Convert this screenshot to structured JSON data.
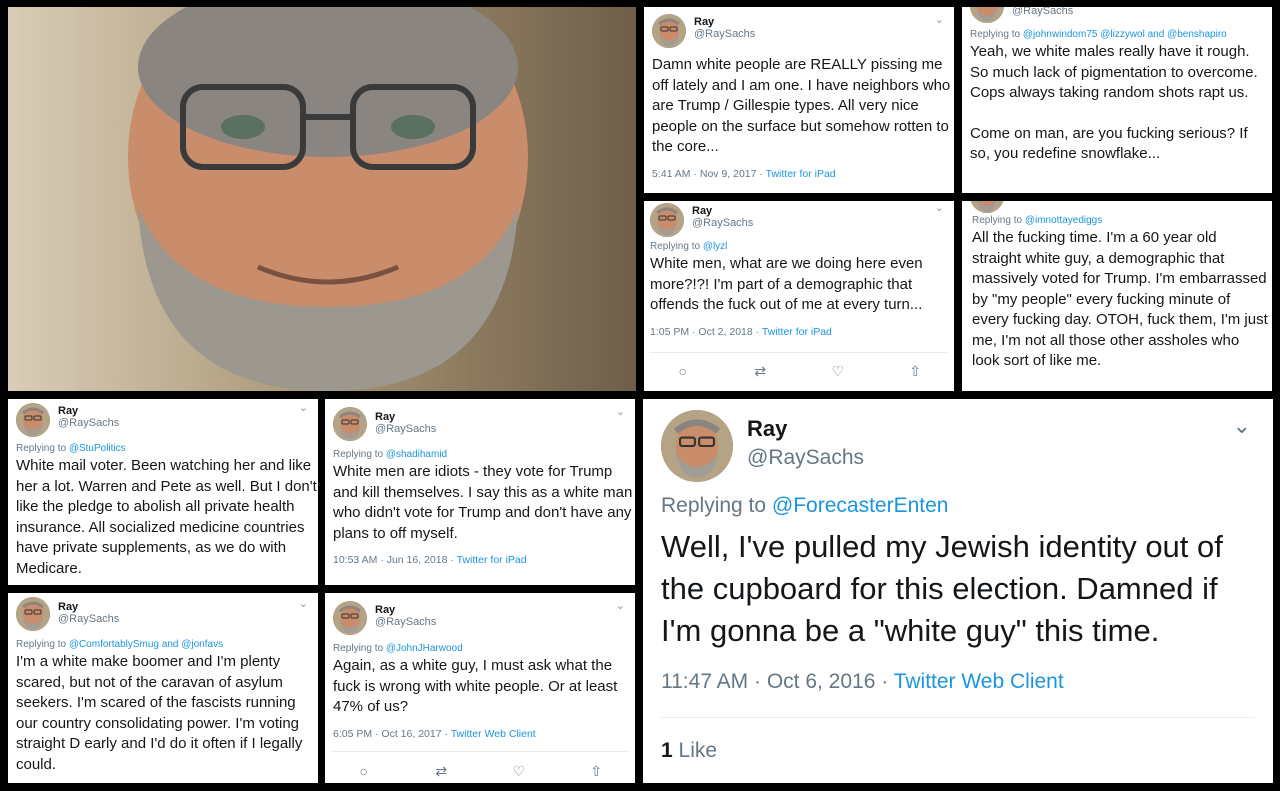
{
  "colors": {
    "link": "#1b95e0",
    "muted": "#657786",
    "text": "#14171a"
  },
  "tweets": {
    "t1": {
      "name": "Ray",
      "handle": "@RaySachs",
      "text": "Damn white people are REALLY pissing me off lately and I am one. I have neighbors who are Trump / Gillespie types. All very nice people on the surface but somehow rotten to the core...",
      "time": "5:41 AM · Nov 9, 2017 · ",
      "client": "Twitter for iPad"
    },
    "t2": {
      "handle": "@RaySachs",
      "replying": "Replying to ",
      "reply_to": "@johnwindom75 @lizzywol and @benshapiro",
      "text": "Yeah, we white males really have it rough. So much lack of pigmentation to overcome. Cops always taking random shots rapt us.",
      "text2": "Come on man, are you fucking serious? If so, you redefine snowflake..."
    },
    "t3": {
      "name": "Ray",
      "handle": "@RaySachs",
      "replying": "Replying to ",
      "reply_to": "@lyzl",
      "text": "White men, what are we doing here even more?!?! I'm part of a demographic that offends the fuck out of me at every turn...",
      "time": "1:05 PM · Oct 2, 2018 · ",
      "client": "Twitter for iPad"
    },
    "t4": {
      "replying": "Replying to ",
      "reply_to": "@imnottayediggs",
      "text": "All the fucking time. I'm a 60 year old straight white guy, a demographic that massively voted for Trump. I'm embarrassed by \"my people\" every fucking minute of every fucking day. OTOH, fuck them, I'm just me, I'm not all those other assholes who look sort of like me."
    },
    "t5": {
      "name": "Ray",
      "handle": "@RaySachs",
      "replying": "Replying to ",
      "reply_to": "@StuPolitics",
      "text": "White mail voter. Been watching her and like her a lot. Warren and Pete as well. But I don't like the pledge to abolish all private health insurance. All socialized medicine countries have private supplements, as we do with Medicare."
    },
    "t6": {
      "name": "Ray",
      "handle": "@RaySachs",
      "replying": "Replying to ",
      "reply_to": "@shadihamid",
      "text": "White men are idiots - they vote for Trump and kill themselves. I say this as a white man who didn't vote for Trump and don't have any plans to off myself.",
      "time": "10:53 AM · Jun 16, 2018 · ",
      "client": "Twitter for iPad"
    },
    "t7": {
      "name": "Ray",
      "handle": "@RaySachs",
      "replying": "Replying to ",
      "reply_to": "@ComfortablySmug and @jonfavs",
      "text": "I'm a white make boomer and I'm plenty scared, but not of the caravan of asylum seekers. I'm scared of the fascists running our country consolidating power. I'm voting straight D early and I'd do it often if I legally could."
    },
    "t8": {
      "name": "Ray",
      "handle": "@RaySachs",
      "replying": "Replying to ",
      "reply_to": "@JohnJHarwood",
      "text": "Again, as a white guy, I must ask what the fuck is wrong with white people. Or at least 47% of us?",
      "time": "6:05 PM · Oct 16, 2017 · ",
      "client": "Twitter Web Client"
    },
    "t9": {
      "name": "Ray",
      "handle": "@RaySachs",
      "replying": "Replying to ",
      "reply_to": "@ForecasterEnten",
      "text": "Well, I've pulled my Jewish identity out of the cupboard for this election. Damned if I'm gonna be a \"white guy\" this time.",
      "time": "11:47 AM · Oct 6, 2016 · ",
      "client": "Twitter Web Client",
      "likes_count": "1",
      "likes_label": " Like"
    }
  }
}
